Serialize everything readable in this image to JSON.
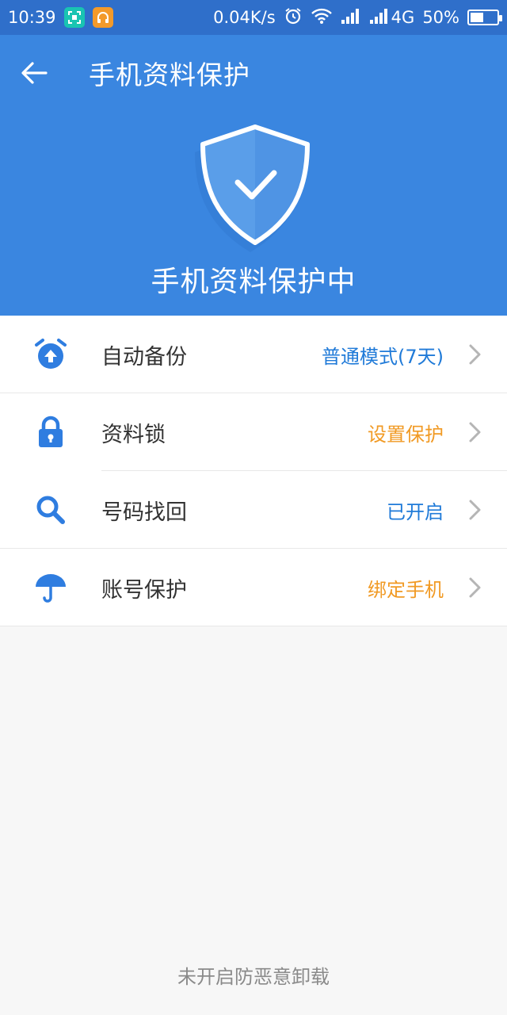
{
  "status_bar": {
    "time": "10:39",
    "net_speed": "0.04K/s",
    "network": "4G",
    "battery": "50%",
    "battery_level": 0.5,
    "icons": [
      "screenshot-icon",
      "headset-app-icon",
      "alarm-icon",
      "wifi-icon",
      "signal-icon",
      "signal-icon-2",
      "battery-icon"
    ]
  },
  "header": {
    "title": "手机资料保护",
    "status": "手机资料保护中",
    "colors": {
      "primary": "#3a86e0",
      "status_bar": "#2f6fca"
    }
  },
  "list": {
    "items": [
      {
        "label": "自动备份",
        "value": "普通模式(7天)",
        "value_color": "blue",
        "icon": "alarm-upload-icon"
      },
      {
        "label": "资料锁",
        "value": "设置保护",
        "value_color": "orange",
        "icon": "lock-icon"
      },
      {
        "label": "号码找回",
        "value": "已开启",
        "value_color": "blue",
        "icon": "search-icon"
      },
      {
        "label": "账号保护",
        "value": "绑定手机",
        "value_color": "orange",
        "icon": "umbrella-icon"
      }
    ]
  },
  "footer": {
    "link": "未开启防恶意卸载"
  }
}
